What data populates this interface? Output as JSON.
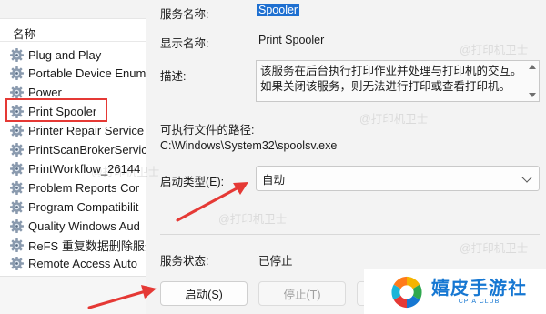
{
  "services_list": {
    "column_header": "名称",
    "items": [
      {
        "label": "Plug and Play"
      },
      {
        "label": "Portable Device Enum"
      },
      {
        "label": "Power"
      },
      {
        "label": "Print Spooler"
      },
      {
        "label": "Printer Repair Service"
      },
      {
        "label": "PrintScanBrokerServic"
      },
      {
        "label": "PrintWorkflow_26144"
      },
      {
        "label": "Problem Reports Cor"
      },
      {
        "label": "Program Compatibilit"
      },
      {
        "label": "Quality Windows Aud"
      },
      {
        "label": "ReFS 重复数据删除服务"
      },
      {
        "label": "Remote Access Auto"
      }
    ],
    "selected_item": "Print Spooler",
    "highlight_color": "#e53935"
  },
  "properties": {
    "service_name_label": "服务名称:",
    "service_name_value": "Spooler",
    "display_name_label": "显示名称:",
    "display_name_value": "Print Spooler",
    "description_label": "描述:",
    "description_value": "该服务在后台执行打印作业并处理与打印机的交互。如果关闭该服务，则无法进行打印或查看打印机。",
    "exe_path_label": "可执行文件的路径:",
    "exe_path_value": "C:\\Windows\\System32\\spoolsv.exe",
    "startup_type_label": "启动类型(E):",
    "startup_type_value": "自动",
    "status_label": "服务状态:",
    "status_value": "已停止",
    "buttons": {
      "start": "启动(S)",
      "stop": "停止(T)"
    }
  },
  "watermark": {
    "text": "@打印机卫士"
  },
  "logo": {
    "title": "嬉皮手游社",
    "subtitle": "CPIA CLUB",
    "brand_color": "#1677d2"
  },
  "colors": {
    "selection": "#1e6fd0",
    "annotation_arrow": "#e53935"
  }
}
